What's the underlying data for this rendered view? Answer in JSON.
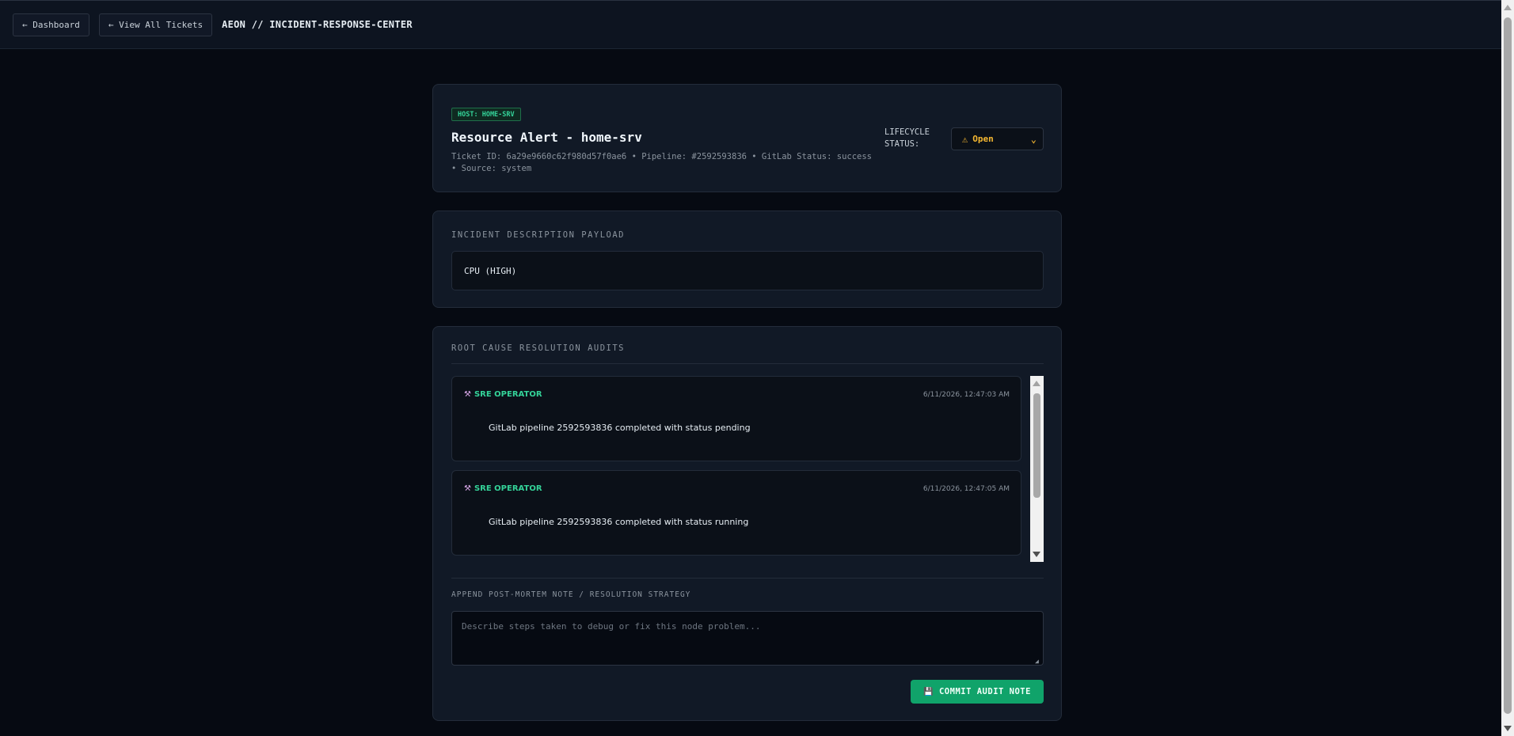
{
  "topbar": {
    "dashboard_label": "← Dashboard",
    "tickets_label": "← View All Tickets",
    "app_title": "AEON // INCIDENT-RESPONSE-CENTER"
  },
  "ticket": {
    "host_badge": "HOST: HOME-SRV",
    "title": "Resource Alert - home-srv",
    "meta": "Ticket ID: 6a29e9660c62f980d57f0ae6 • Pipeline: #2592593836 • GitLab Status: success • Source: system",
    "lifecycle_label": "LIFECYCLE STATUS:",
    "status_value": "Open",
    "status_color": "#f5b731"
  },
  "description": {
    "label": "INCIDENT DESCRIPTION PAYLOAD",
    "payload": "CPU (HIGH)"
  },
  "audits": {
    "label": "ROOT CAUSE RESOLUTION AUDITS",
    "items": [
      {
        "author": "SRE OPERATOR",
        "timestamp": "6/11/2026, 12:47:03 AM",
        "message": "GitLab pipeline 2592593836 completed with status pending"
      },
      {
        "author": "SRE OPERATOR",
        "timestamp": "6/11/2026, 12:47:05 AM",
        "message": "GitLab pipeline 2592593836 completed with status running"
      }
    ]
  },
  "note": {
    "label": "APPEND POST-MORTEM NOTE / RESOLUTION STRATEGY",
    "placeholder": "Describe steps taken to debug or fix this node problem...",
    "value": "",
    "commit_label": "COMMIT AUDIT NOTE"
  },
  "icons": {
    "warning": "warning-icon",
    "chevron": "chevron-down-icon",
    "tools": "tools-icon",
    "save": "save-icon"
  },
  "colors": {
    "accent_green": "#10a36a",
    "badge_green": "#34d399",
    "background": "#060a12",
    "card": "#111926"
  }
}
